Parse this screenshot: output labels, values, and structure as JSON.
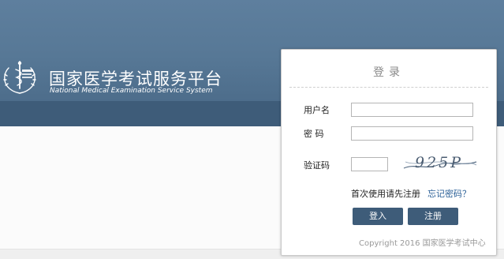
{
  "header": {
    "title_cn": "国家医学考试服务平台",
    "title_en": "National Medical Examination Service System",
    "logo_icon": "medical-caduceus-seal",
    "colors": {
      "band": "#577896",
      "strip": "#3e5c79"
    }
  },
  "login": {
    "title": "登录",
    "username_label": "用户名",
    "username_value": "",
    "password_label": "密 码",
    "password_value": "",
    "captcha_label": "验证码",
    "captcha_value": "",
    "captcha_image_text": "925P",
    "first_use_text": "首次使用请先注册",
    "forgot_link": "忘记密码？",
    "login_button": "登入",
    "register_button": "注册",
    "copyright": "Copyright 2016 国家医学考试中心",
    "colors": {
      "button": "#3e5c79",
      "link": "#2a5f97"
    }
  }
}
